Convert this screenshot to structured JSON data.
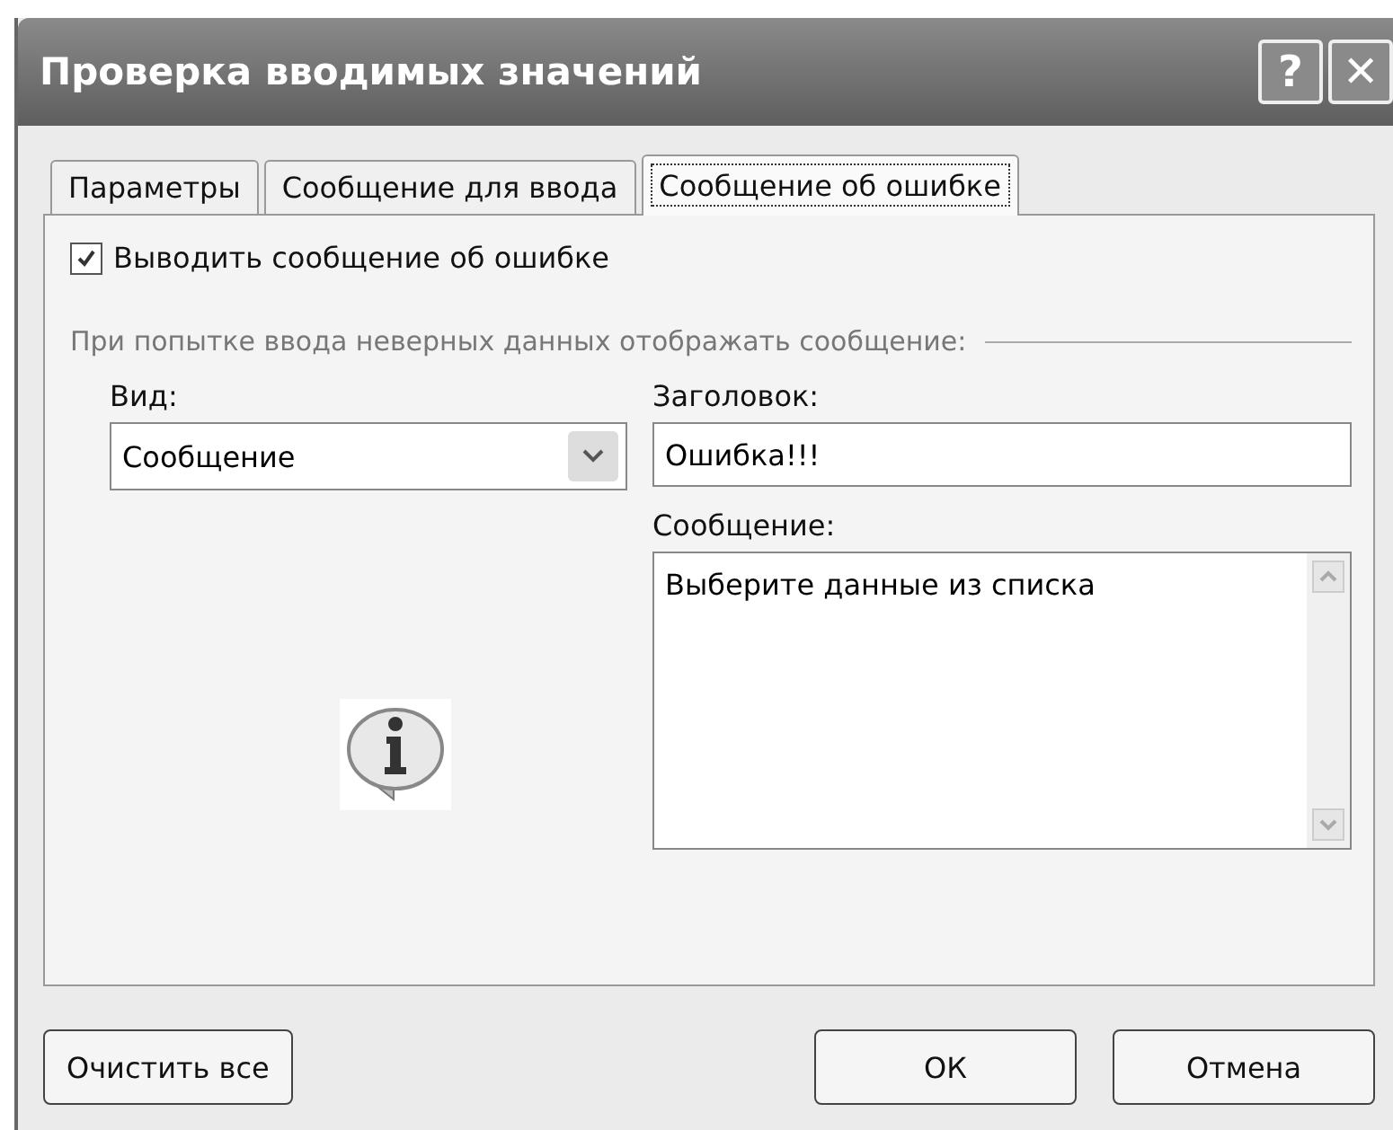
{
  "window": {
    "title": "Проверка вводимых значений",
    "help_button": "?",
    "close_button": "✕"
  },
  "tabs": [
    {
      "label": "Параметры",
      "selected": false
    },
    {
      "label": "Сообщение для ввода",
      "selected": false
    },
    {
      "label": "Сообщение об ошибке",
      "selected": true
    }
  ],
  "show_error": {
    "label": "Выводить сообщение об ошибке",
    "checked": true
  },
  "group_label": "При попытке ввода неверных данных отображать сообщение:",
  "style": {
    "label": "Вид:",
    "value": "Сообщение"
  },
  "title_field": {
    "label": "Заголовок:",
    "value": "Ошибка!!!"
  },
  "message_field": {
    "label": "Сообщение:",
    "value": "Выберите данные из списка"
  },
  "buttons": [
    {
      "kind": "clear",
      "label": "Очистить все"
    },
    {
      "kind": "ok",
      "label": "ОК"
    },
    {
      "kind": "cancel",
      "label": "Отмена"
    }
  ]
}
